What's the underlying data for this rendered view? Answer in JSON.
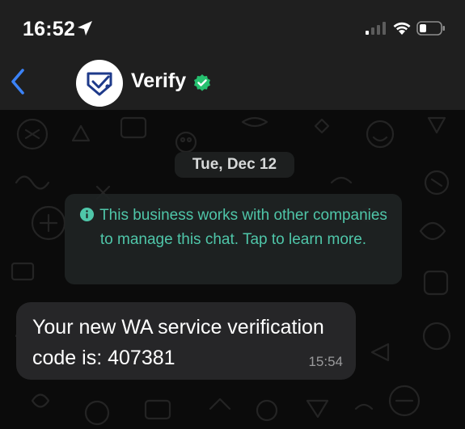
{
  "status_bar": {
    "time": "16:52",
    "icons": [
      "location-arrow-icon",
      "signal-bars-icon",
      "wifi-icon",
      "battery-icon"
    ]
  },
  "header": {
    "back_icon": "chevron-left-icon",
    "contact_name": "Verify",
    "verified": true,
    "avatar_icon": "verify-logo-icon"
  },
  "chat": {
    "date_label": "Tue, Dec 12",
    "info_icon": "info-circle-icon",
    "info_message": "This business works with other companies to manage this chat. Tap to learn more.",
    "messages": [
      {
        "text": "Your new WA service verification code is: 407381",
        "time": "15:54"
      }
    ]
  },
  "colors": {
    "accent_blue": "#3b82f6",
    "info_teal": "#4fc6a9",
    "verified_green": "#25c16f",
    "bubble_bg": "#262628",
    "bar_bg": "#1f1f1f"
  }
}
